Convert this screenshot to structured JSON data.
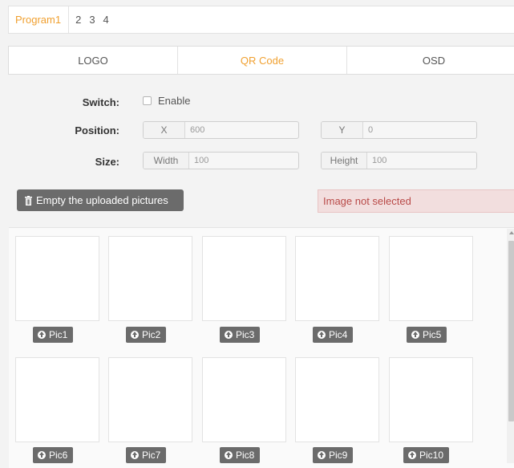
{
  "program_tabs": [
    "Program1",
    "2",
    "3",
    "4"
  ],
  "function_tabs": [
    "LOGO",
    "QR Code",
    "OSD"
  ],
  "form": {
    "switch_label": "Switch:",
    "enable_label": "Enable",
    "position_label": "Position:",
    "x_label": "X",
    "x_value": "600",
    "y_label": "Y",
    "y_value": "0",
    "size_label": "Size:",
    "width_label": "Width",
    "width_value": "100",
    "height_label": "Height",
    "height_value": "100"
  },
  "empty_button_label": "Empty the uploaded pictures",
  "alert_text": "Image not selected",
  "pics": [
    "Pic1",
    "Pic2",
    "Pic3",
    "Pic4",
    "Pic5",
    "Pic6",
    "Pic7",
    "Pic8",
    "Pic9",
    "Pic10"
  ],
  "colors": {
    "accent": "#f0a030",
    "button": "#6b6b6b",
    "alert_bg": "#f2dede",
    "alert_text": "#b94a48"
  },
  "icons": {
    "trash": "trash-icon",
    "upload": "upload-circle-icon"
  }
}
